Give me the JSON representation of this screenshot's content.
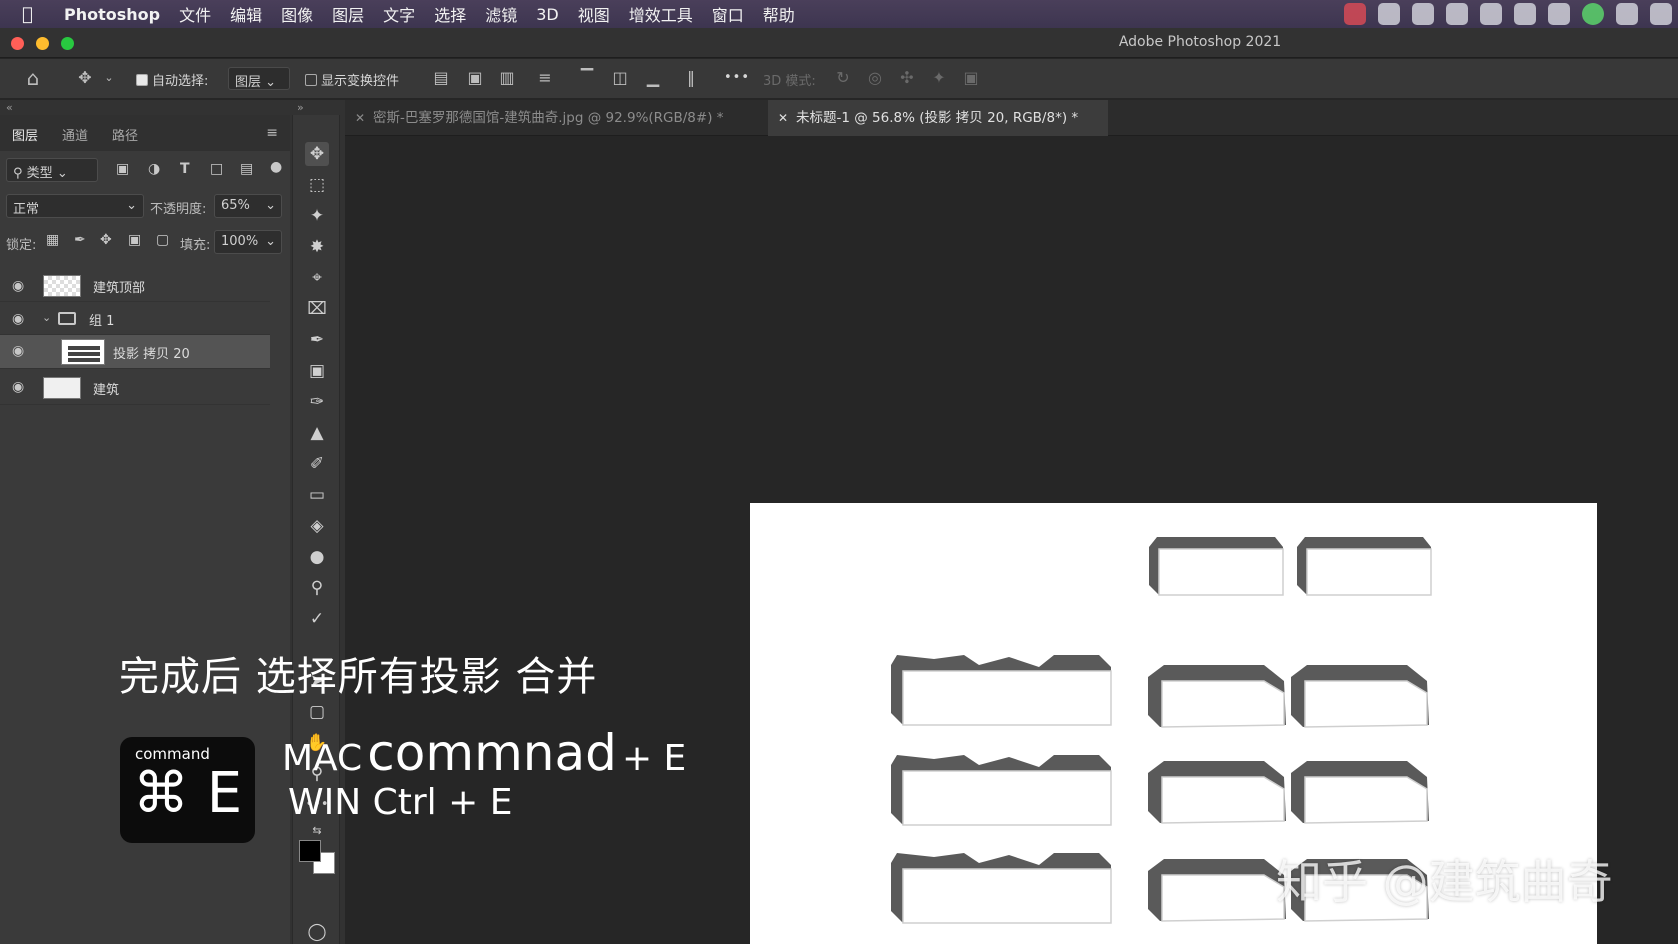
{
  "menubar": {
    "app": "Photoshop",
    "items": [
      "文件",
      "编辑",
      "图像",
      "图层",
      "文字",
      "选择",
      "滤镜",
      "3D",
      "视图",
      "增效工具",
      "窗口",
      "帮助"
    ]
  },
  "window": {
    "title": "Adobe Photoshop 2021"
  },
  "options": {
    "auto_select_label": "自动选择:",
    "auto_select_checked": true,
    "auto_select_target": "图层",
    "show_transform_label": "显示变换控件",
    "show_transform_checked": false,
    "more": "•••",
    "mode_3d_label": "3D 模式:"
  },
  "layers_panel": {
    "tabs": [
      "图层",
      "通道",
      "路径"
    ],
    "active_tab": "图层",
    "filter_label": "类型",
    "blend_mode": "正常",
    "opacity_label": "不透明度:",
    "opacity_value": "65%",
    "lock_label": "锁定:",
    "fill_label": "填充:",
    "fill_value": "100%",
    "layers": [
      {
        "name": "建筑顶部",
        "visible": true,
        "selected": false,
        "type": "pixel"
      },
      {
        "name": "组 1",
        "visible": true,
        "selected": false,
        "type": "group"
      },
      {
        "name": "投影 拷贝 20",
        "visible": true,
        "selected": true,
        "type": "pixel"
      },
      {
        "name": "建筑",
        "visible": true,
        "selected": false,
        "type": "pixel"
      }
    ]
  },
  "doc_tabs": [
    {
      "label": "密斯-巴塞罗那德国馆-建筑曲奇.jpg @ 92.9%(RGB/8#) *",
      "active": false
    },
    {
      "label": "未标题-1 @ 56.8% (投影 拷贝 20, RGB/8*) *",
      "active": true
    }
  ],
  "overlay": {
    "caption": "完成后 选择所有投影 合并",
    "keycap_label": "command",
    "keycap_key": "⌘ E",
    "mac_prefix": "MAC",
    "mac_word": "commnad",
    "mac_suffix": "+ E",
    "win_shortcut": "WIN Ctrl + E",
    "watermark": "知乎 @建筑曲奇"
  },
  "colors": {
    "accent_menubar": "#3d3550",
    "panel": "#3a3a3a",
    "canvas_bg": "#262626",
    "shadow_gray": "#5a5a5a"
  }
}
